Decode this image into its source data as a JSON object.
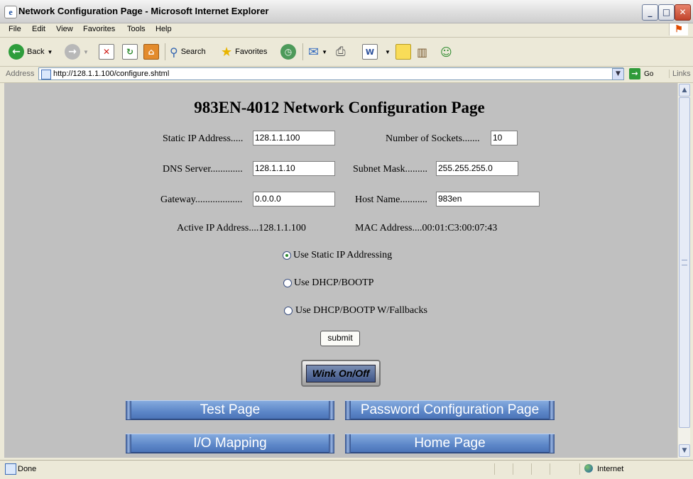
{
  "window": {
    "title": "Network Configuration Page - Microsoft Internet Explorer",
    "minimize": "_",
    "maximize": "□",
    "close": "✕"
  },
  "menu": [
    "File",
    "Edit",
    "View",
    "Favorites",
    "Tools",
    "Help"
  ],
  "toolbar": {
    "back": "Back",
    "search": "Search",
    "favorites": "Favorites"
  },
  "address": {
    "label": "Address",
    "url": "http://128.1.1.100/configure.shtml",
    "go": "Go",
    "links": "Links"
  },
  "page": {
    "title": "983EN-4012 Network Configuration Page",
    "fields": {
      "static_ip": {
        "label": "Static IP Address.....",
        "value": "128.1.1.100"
      },
      "sockets": {
        "label": "Number of Sockets.......",
        "value": "10"
      },
      "dns": {
        "label": "DNS Server.............",
        "value": "128.1.1.10"
      },
      "subnet": {
        "label": "Subnet Mask.........",
        "value": "255.255.255.0"
      },
      "gateway": {
        "label": "Gateway...................",
        "value": "0.0.0.0"
      },
      "host": {
        "label": "Host Name...........",
        "value": "983en"
      }
    },
    "active_ip": "Active IP Address....128.1.1.100",
    "mac": "MAC Address....00:01:C3:00:07:43",
    "radios": [
      {
        "label": "Use Static IP Addressing",
        "checked": true
      },
      {
        "label": "Use DHCP/BOOTP",
        "checked": false
      },
      {
        "label": "Use DHCP/BOOTP W/Fallbacks",
        "checked": false
      }
    ],
    "submit": "submit",
    "wink": "Wink On/Off",
    "nav": {
      "test": "Test Page",
      "password": "Password Configuration Page",
      "io": "I/O Mapping",
      "home": "Home Page"
    }
  },
  "status": {
    "text": "Done",
    "zone": "Internet"
  }
}
